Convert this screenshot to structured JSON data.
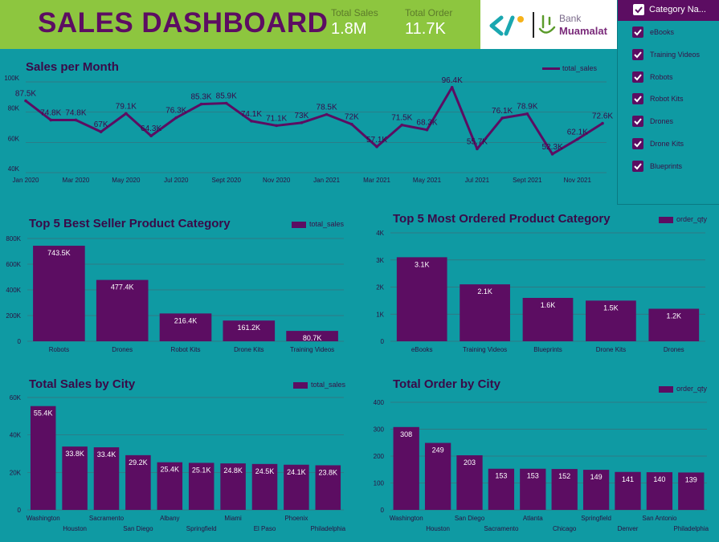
{
  "header": {
    "title": "SALES DASHBOARD",
    "kpis": [
      {
        "label": "Total Sales",
        "value": "1.8M"
      },
      {
        "label": "Total Order",
        "value": "11.7K"
      }
    ],
    "bank_logo": {
      "line1": "Bank",
      "line2": "Muamalat"
    }
  },
  "filter": {
    "header_label": "Category Na...",
    "items": [
      "eBooks",
      "Training Videos",
      "Robots",
      "Robot Kits",
      "Drones",
      "Drone Kits",
      "Blueprints"
    ]
  },
  "colors": {
    "bar": "#5c0d62",
    "line": "#5c0d62",
    "header": "#8dc63f",
    "background": "#0f9aa3",
    "grid": "#3b6e7a"
  },
  "chart_data": [
    {
      "id": "sales-per-month",
      "type": "line",
      "title": "Sales per Month",
      "legend": "total_sales",
      "legend_position": "top-right",
      "x_tick_labels": [
        "Jan 2020",
        "Mar 2020",
        "May 2020",
        "Jul 2020",
        "Sept 2020",
        "Nov 2020",
        "Jan 2021",
        "Mar 2021",
        "May 2021",
        "Jul 2021",
        "Sept 2021",
        "Nov 2021"
      ],
      "y_tick_labels": [
        "40K",
        "60K",
        "80K",
        "100K"
      ],
      "ylim": [
        40000,
        100000
      ],
      "values": [
        87500,
        74800,
        74800,
        67000,
        79100,
        64300,
        76300,
        85300,
        85900,
        74100,
        71100,
        73000,
        78500,
        72000,
        57100,
        71500,
        68300,
        96400,
        55700,
        76100,
        78900,
        52300,
        62100,
        72600
      ],
      "labels": [
        "87.5K",
        "74.8K",
        "74.8K",
        "67K",
        "79.1K",
        "64.3K",
        "76.3K",
        "85.3K",
        "85.9K",
        "74.1K",
        "71.1K",
        "73K",
        "78.5K",
        "72K",
        "57.1K",
        "71.5K",
        "68.3K",
        "96.4K",
        "55.7K",
        "76.1K",
        "78.9K",
        "52.3K",
        "62.1K",
        "72.6K"
      ]
    },
    {
      "id": "top5-best-seller",
      "type": "bar",
      "title": "Top 5 Best Seller Product Category",
      "legend": "total_sales",
      "categories": [
        "Robots",
        "Drones",
        "Robot Kits",
        "Drone Kits",
        "Training Videos"
      ],
      "values": [
        743500,
        477400,
        216400,
        161200,
        80700
      ],
      "labels": [
        "743.5K",
        "477.4K",
        "216.4K",
        "161.2K",
        "80.7K"
      ],
      "y_tick_labels": [
        "0",
        "200K",
        "400K",
        "600K",
        "800K"
      ],
      "ylim": [
        0,
        800000
      ]
    },
    {
      "id": "top5-most-ordered",
      "type": "bar",
      "title": "Top 5 Most Ordered Product Category",
      "legend": "order_qty",
      "categories": [
        "eBooks",
        "Training Videos",
        "Blueprints",
        "Drone Kits",
        "Drones"
      ],
      "values": [
        3100,
        2100,
        1600,
        1500,
        1200
      ],
      "labels": [
        "3.1K",
        "2.1K",
        "1.6K",
        "1.5K",
        "1.2K"
      ],
      "y_tick_labels": [
        "0",
        "1K",
        "2K",
        "3K",
        "4K"
      ],
      "ylim": [
        0,
        4000
      ]
    },
    {
      "id": "total-sales-by-city",
      "type": "bar",
      "title": "Total Sales by City",
      "legend": "total_sales",
      "categories": [
        "Washington",
        "Houston",
        "Sacramento",
        "San Diego",
        "Albany",
        "Springfield",
        "Miami",
        "El Paso",
        "Phoenix",
        "Philadelphia"
      ],
      "values": [
        55400,
        33800,
        33400,
        29200,
        25400,
        25100,
        24800,
        24500,
        24100,
        23800
      ],
      "labels": [
        "55.4K",
        "33.8K",
        "33.4K",
        "29.2K",
        "25.4K",
        "25.1K",
        "24.8K",
        "24.5K",
        "24.1K",
        "23.8K"
      ],
      "y_tick_labels": [
        "0",
        "20K",
        "40K",
        "60K"
      ],
      "ylim": [
        0,
        60000
      ]
    },
    {
      "id": "total-order-by-city",
      "type": "bar",
      "title": "Total Order by City",
      "legend": "order_qty",
      "categories": [
        "Washington",
        "Houston",
        "San Diego",
        "Sacramento",
        "Atlanta",
        "Chicago",
        "Springfield",
        "Denver",
        "San Antonio",
        "Philadelphia"
      ],
      "values": [
        308,
        249,
        203,
        153,
        153,
        152,
        149,
        141,
        140,
        139
      ],
      "labels": [
        "308",
        "249",
        "203",
        "153",
        "153",
        "152",
        "149",
        "141",
        "140",
        "139"
      ],
      "y_tick_labels": [
        "0",
        "100",
        "200",
        "300",
        "400"
      ],
      "ylim": [
        0,
        400
      ]
    }
  ]
}
